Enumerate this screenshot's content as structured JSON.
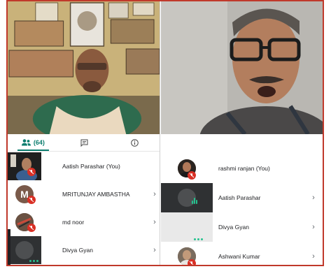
{
  "left_panel": {
    "tabs": [
      {
        "icon": "people-icon",
        "count": "(64)",
        "active": true
      },
      {
        "icon": "chat-icon",
        "active": false
      },
      {
        "icon": "info-icon",
        "active": false
      }
    ],
    "participants": [
      {
        "name": "Aatish Parashar (You)",
        "thumb": "video",
        "muted": true,
        "chevron": false
      },
      {
        "name": "MRITUNJAY AMBASTHA",
        "avatar_letter": "M",
        "muted": true,
        "chevron": true
      },
      {
        "name": "md noor",
        "avatar": "photo",
        "muted": true,
        "chevron": true
      },
      {
        "name": "Divya Gyan",
        "thumb": "dark",
        "speaking_dots": true,
        "chevron": true
      }
    ]
  },
  "right_panel": {
    "participants": [
      {
        "name": "rashmi ranjan (You)",
        "avatar": "photo",
        "muted": true,
        "chevron": false
      },
      {
        "name": "Aatish Parashar",
        "thumb": "dark",
        "audio_active": true,
        "chevron": true
      },
      {
        "name": "Divya Gyan",
        "thumb": "grey",
        "speaking_dots": true,
        "chevron": true
      },
      {
        "name": "Ashwani Kumar",
        "avatar": "photo",
        "muted": true,
        "chevron": true
      }
    ]
  },
  "colors": {
    "accent": "#0b7d6e",
    "muted_badge": "#d93025",
    "audio_active": "#25c28f",
    "frame_border": "#c0392b"
  }
}
